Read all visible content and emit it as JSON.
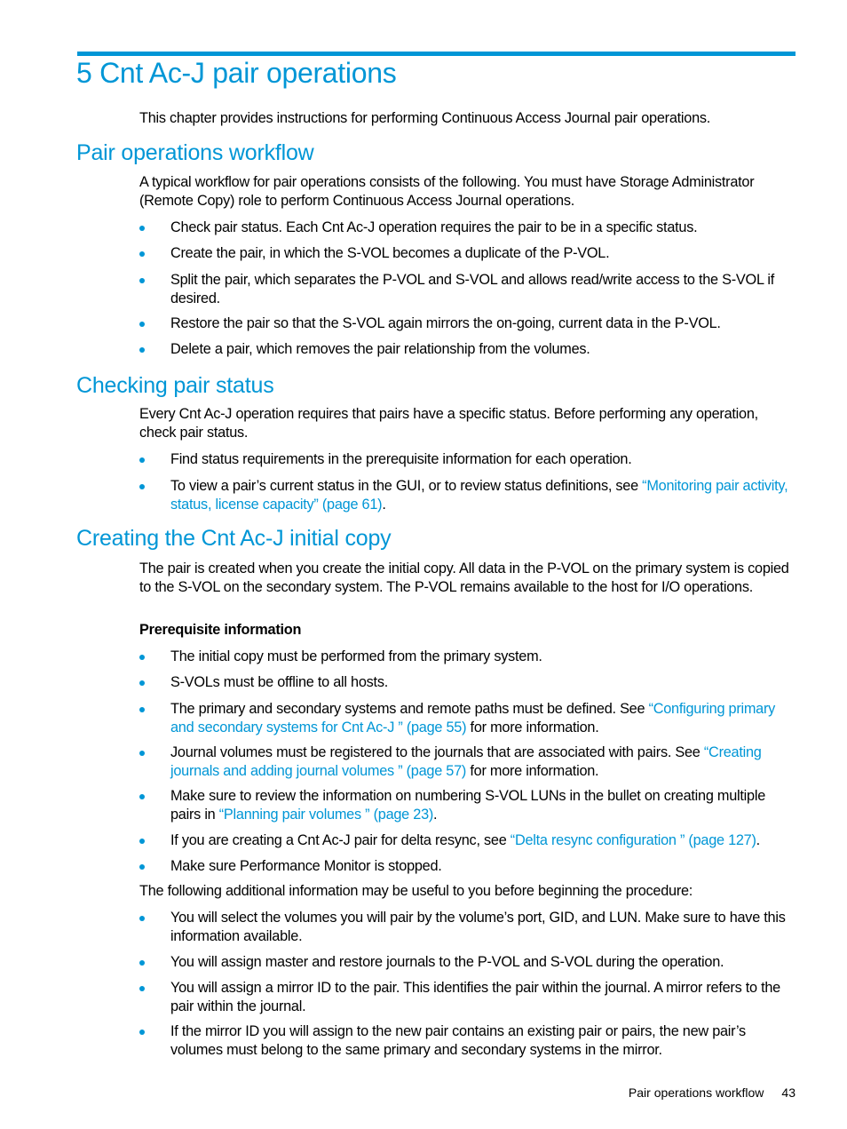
{
  "colors": {
    "accent": "#0096d6",
    "text": "#000000"
  },
  "chapter": {
    "title": "5 Cnt Ac-J pair operations",
    "intro": "This chapter provides instructions for performing Continuous Access Journal pair operations."
  },
  "workflow": {
    "heading": "Pair operations workflow",
    "intro": "A typical workflow for pair operations consists of the following. You must have Storage Administrator (Remote Copy) role to perform Continuous Access Journal operations.",
    "items": [
      "Check pair status. Each Cnt Ac-J operation requires the pair to be in a specific status.",
      "Create the pair, in which the S-VOL becomes a duplicate of the P-VOL.",
      "Split the pair, which separates the P-VOL and S-VOL and allows read/write access to the S-VOL if desired.",
      "Restore the pair so that the S-VOL again mirrors the on-going, current data in the P-VOL.",
      "Delete a pair, which removes the pair relationship from the volumes."
    ]
  },
  "checking": {
    "heading": "Checking pair status",
    "intro": "Every Cnt Ac-J operation requires that pairs have a specific status. Before performing any operation, check pair status.",
    "item1": "Find status requirements in the prerequisite information for each operation.",
    "item2": {
      "before": "To view a pair’s current status in the GUI, or to review status definitions, see ",
      "link": "“Monitoring pair activity, status, license capacity” (page 61)",
      "after": "."
    }
  },
  "creating": {
    "heading": "Creating the Cnt Ac-J initial copy",
    "intro": "The pair is created when you create the initial copy. All data in the P-VOL on the primary system is copied to the S-VOL on the secondary system. The P-VOL remains available to the host for I/O operations.",
    "prereq_label": "Prerequisite information",
    "prereq1": "The initial copy must be performed from the primary system.",
    "prereq2": "S-VOLs must be offline to all hosts.",
    "prereq3": {
      "before": "The primary and secondary systems and remote paths must be defined. See ",
      "link": "“Configuring primary and secondary systems for Cnt Ac-J ” (page 55)",
      "after": " for more information."
    },
    "prereq4": {
      "before": "Journal volumes must be registered to the journals that are associated with pairs. See ",
      "link": "“Creating journals and adding journal volumes ” (page 57)",
      "after": " for more information."
    },
    "prereq5": {
      "before": "Make sure to review the information on numbering S-VOL LUNs in the bullet on creating multiple pairs in ",
      "link": "“Planning pair volumes ” (page 23)",
      "after": "."
    },
    "prereq6": {
      "before": "If you are creating a Cnt Ac-J pair for delta resync, see ",
      "link": "“Delta resync configuration ” (page 127)",
      "after": "."
    },
    "prereq7": "Make sure Performance Monitor is stopped.",
    "additional_intro": "The following additional information may be useful to you before beginning the procedure:",
    "additional": [
      "You will select the volumes you will pair by the volume’s port, GID, and LUN. Make sure to have this information available.",
      "You will assign master and restore journals to the P-VOL and S-VOL during the operation.",
      "You will assign a mirror ID to the pair. This identifies the pair within the journal. A mirror refers to the pair within the journal.",
      "If the mirror ID you will assign to the new pair contains an existing pair or pairs, the new pair’s volumes must belong to the same primary and secondary systems in the mirror."
    ]
  },
  "footer": {
    "section": "Pair operations workflow",
    "page": "43"
  }
}
